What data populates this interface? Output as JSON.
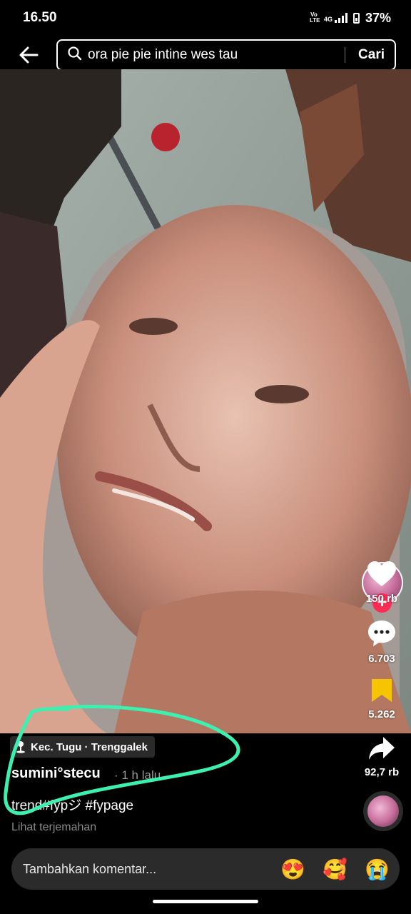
{
  "status_bar": {
    "time": "16.50",
    "battery": "37%",
    "network": "4G",
    "volte": "Vo LTE"
  },
  "search": {
    "query": "ora pie pie intine wes tau",
    "submit_label": "Cari"
  },
  "video": {
    "likes": "150 rb",
    "comments": "6.703",
    "saves": "5.262",
    "shares": "92,7 rb",
    "location": "Kec. Tugu · Trenggalek",
    "username": "sumini°stecu",
    "posted": "· 1 h lalu",
    "caption": "trend#fypジ #fypage",
    "translate_label": "Lihat terjemahan"
  },
  "comment_bar": {
    "placeholder": "Tambahkan komentar...",
    "emojis": [
      "😍",
      "🥰",
      "😭"
    ]
  },
  "colors": {
    "accent": "#fe2c55",
    "save_yellow": "#f6c400",
    "annotation": "#3ef0b0"
  }
}
